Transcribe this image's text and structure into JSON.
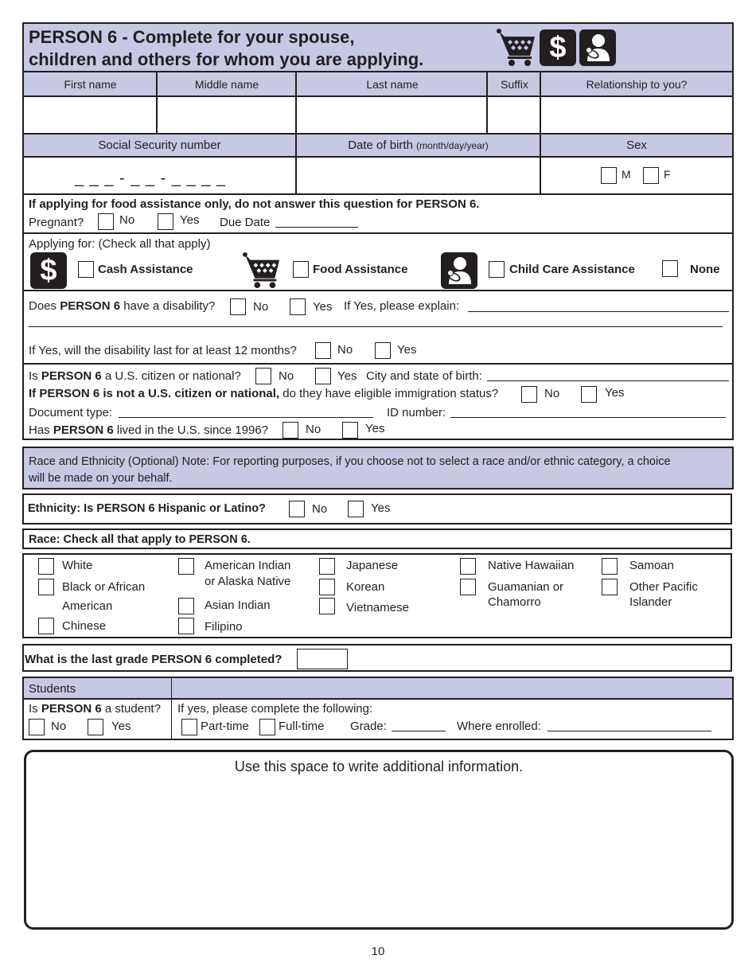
{
  "header": {
    "title_line1": "PERSON 6 - Complete for your spouse,",
    "title_line2": "children and others for whom you are applying.",
    "icons": [
      "shopping-cart-icon",
      "dollar-icon",
      "child-care-icon"
    ]
  },
  "name_row": {
    "columns": [
      "First name",
      "Middle name",
      "Last name",
      "Suffix",
      "Relationship to you?"
    ],
    "values": [
      "",
      "",
      "",
      "",
      ""
    ]
  },
  "id_row": {
    "ssn_label": "Social Security number",
    "dob_label": "Date of birth",
    "dob_hint": "(month/day/year)",
    "sex_label": "Sex",
    "ssn_placeholder": "_ _ _ - _ _ - _ _ _ _",
    "ssn_dash": "-",
    "sex_options": [
      "M",
      "F"
    ]
  },
  "pregnancy": {
    "note": "If applying for food assistance only, do not answer this question for PERSON 6.",
    "question": "Pregnant?",
    "no": "No",
    "yes": "Yes",
    "due_date_label": "Due Date"
  },
  "applying_for": {
    "label": "Applying for: (Check all that apply)",
    "options": [
      "Cash Assistance",
      "Food Assistance",
      "Child Care Assistance",
      "None"
    ]
  },
  "disability": {
    "q_prefix": "Does",
    "q_bold": "PERSON 6",
    "q_suffix": "have a disability?",
    "no": "No",
    "yes": "Yes",
    "explain_label": "If Yes, please explain:",
    "duration_question": "If Yes, will the disability last for at least 12 months?"
  },
  "citizenship": {
    "q1_prefix": "Is",
    "q1_bold": "PERSON 6",
    "q1_suffix": "a U.S. citizen or national?",
    "no": "No",
    "yes": "Yes",
    "birthplace_label": "City and state of birth:",
    "q2_bold": "If PERSON 6 is not a U.S. citizen or national,",
    "q2_suffix": "do they have eligible immigration status?",
    "doc_type_label": "Document type:",
    "id_number_label": "ID number:",
    "q3_prefix": "Has",
    "q3_bold": "PERSON 6",
    "q3_suffix": "lived in the U.S. since 1996?"
  },
  "race_ethnicity_note": {
    "line1": "Race and Ethnicity (Optional) Note: For reporting purposes, if you choose not to select a race and/or ethnic category, a choice",
    "line2": "will be made on your behalf."
  },
  "ethnicity": {
    "question": "Ethnicity: Is PERSON 6 Hispanic or Latino?",
    "no": "No",
    "yes": "Yes"
  },
  "race": {
    "header": "Race: Check all that apply to PERSON 6.",
    "options": {
      "white": "White",
      "black_1": "Black or African",
      "black_2": "American",
      "chinese": "Chinese",
      "am_indian_1": "American Indian",
      "am_indian_2": "or Alaska Native",
      "asian_indian": "Asian Indian",
      "filipino": "Filipino",
      "japanese": "Japanese",
      "korean": "Korean",
      "vietnamese": "Vietnamese",
      "hawaiian": "Native Hawaiian",
      "guamanian_1": "Guamanian or",
      "guamanian_2": "Chamorro",
      "samoan": "Samoan",
      "other_pi_1": "Other Pacific",
      "other_pi_2": "Islander"
    }
  },
  "grade": {
    "question": "What is the last grade PERSON 6 completed?",
    "value": ""
  },
  "students": {
    "header": "Students",
    "q_prefix": "Is",
    "q_bold": "PERSON 6",
    "q_suffix": "a student?",
    "no": "No",
    "yes": "Yes",
    "followup": "If yes, please complete the following:",
    "part_time": "Part-time",
    "full_time": "Full-time",
    "grade_label": "Grade:",
    "enrolled_label": "Where enrolled:"
  },
  "additional": {
    "label": "Use this space to write additional information."
  },
  "footer": {
    "page_number": "10"
  },
  "colors": {
    "header_fill": "#c7c8e1",
    "ink": "#231f20"
  }
}
